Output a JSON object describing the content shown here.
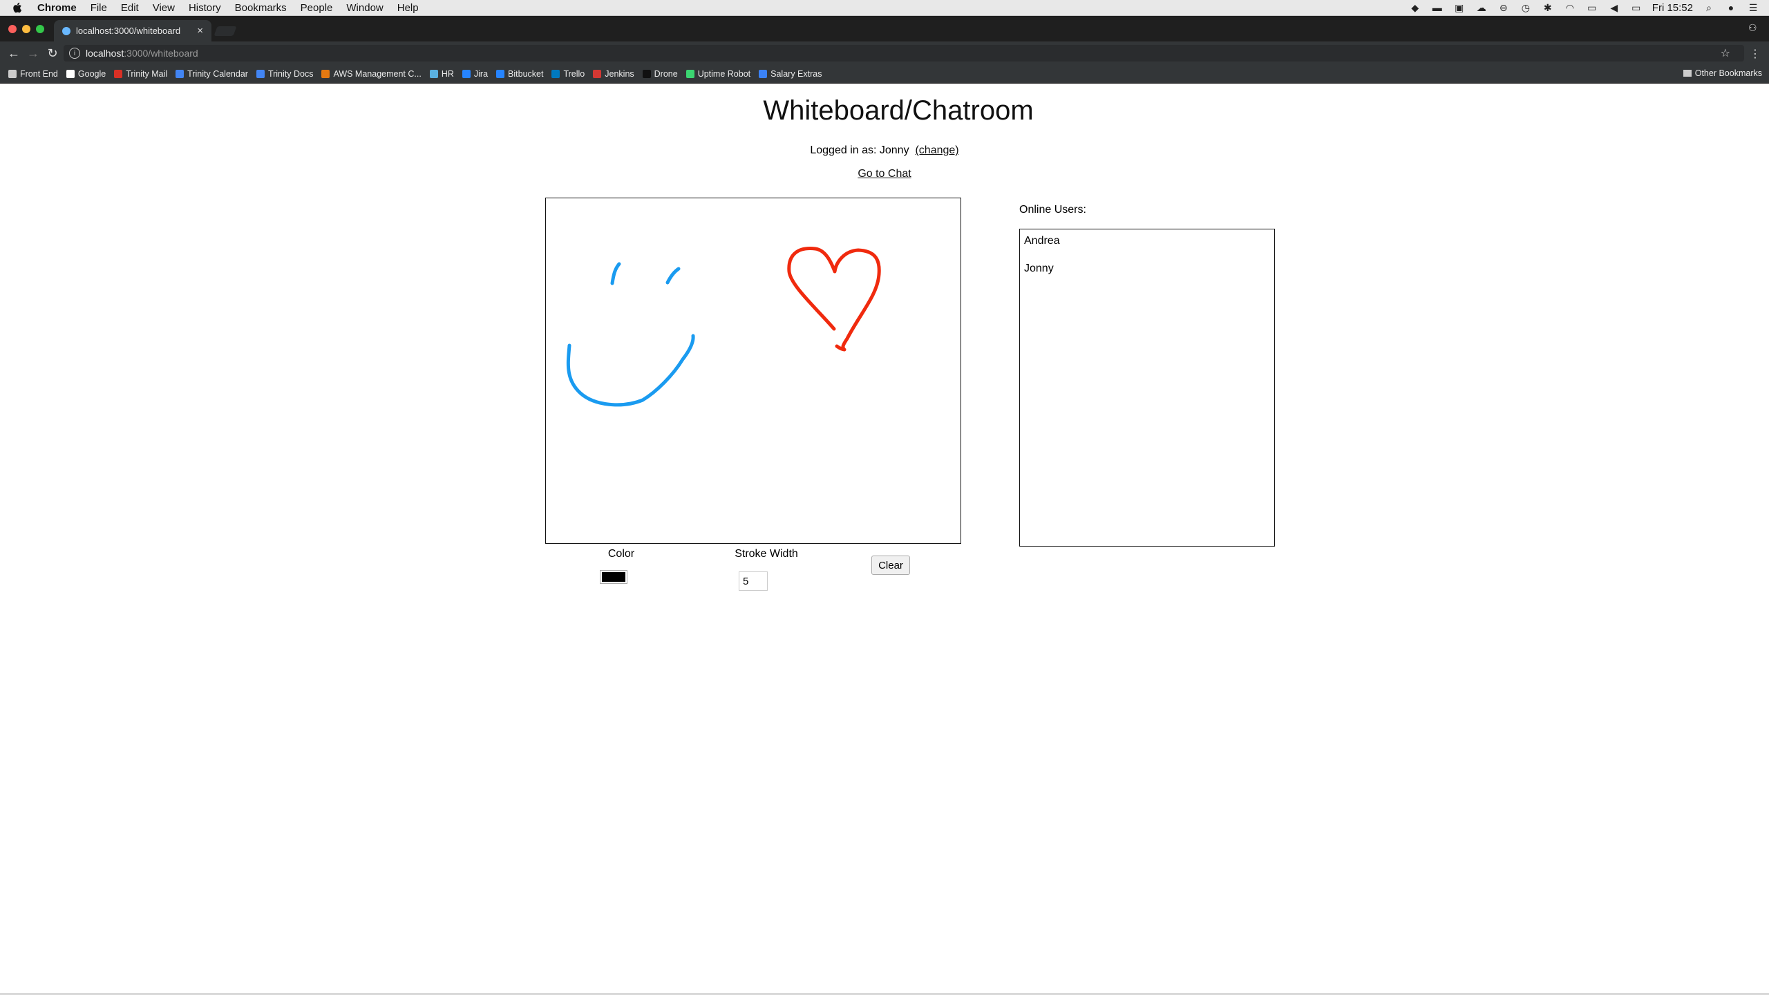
{
  "menubar": {
    "app": "Chrome",
    "items": [
      "File",
      "Edit",
      "View",
      "History",
      "Bookmarks",
      "People",
      "Window",
      "Help"
    ],
    "clock": "Fri 15:52"
  },
  "browser": {
    "tab_title": "localhost:3000/whiteboard",
    "url_host": "localhost",
    "url_path": ":3000/whiteboard",
    "bookmarks": [
      {
        "label": "Front End",
        "icon": "folder-icon",
        "color": "#cccccc"
      },
      {
        "label": "Google",
        "icon": "google-icon",
        "color": "#ffffff"
      },
      {
        "label": "Trinity Mail",
        "icon": "mail-icon",
        "color": "#d93025"
      },
      {
        "label": "Trinity Calendar",
        "icon": "calendar-icon",
        "color": "#4285f4"
      },
      {
        "label": "Trinity Docs",
        "icon": "docs-icon",
        "color": "#4285f4"
      },
      {
        "label": "AWS Management C...",
        "icon": "aws-icon",
        "color": "#e47911"
      },
      {
        "label": "HR",
        "icon": "hr-icon",
        "color": "#5ab0e0"
      },
      {
        "label": "Jira",
        "icon": "jira-icon",
        "color": "#2684ff"
      },
      {
        "label": "Bitbucket",
        "icon": "bitbucket-icon",
        "color": "#2684ff"
      },
      {
        "label": "Trello",
        "icon": "trello-icon",
        "color": "#0079bf"
      },
      {
        "label": "Jenkins",
        "icon": "jenkins-icon",
        "color": "#d33833"
      },
      {
        "label": "Drone",
        "icon": "drone-icon",
        "color": "#111111"
      },
      {
        "label": "Uptime Robot",
        "icon": "uptime-icon",
        "color": "#3bd671"
      },
      {
        "label": "Salary Extras",
        "icon": "salary-icon",
        "color": "#3b82f6"
      }
    ],
    "other_bookmarks": "Other Bookmarks"
  },
  "page": {
    "title": "Whiteboard/Chatroom",
    "logged_in_prefix": "Logged in as: Jonny",
    "change_link": "(change)",
    "go_to_chat": "Go to Chat",
    "color_label": "Color",
    "color_value": "#000000",
    "stroke_label": "Stroke Width",
    "stroke_value": "5",
    "clear_label": "Clear",
    "online_label": "Online Users:",
    "users": [
      "Andrea",
      "Jonny"
    ]
  },
  "drawing": {
    "strokes": [
      {
        "color": "#1a9bf0",
        "shape": "smile"
      },
      {
        "color": "#1a9bf0",
        "shape": "left-eye"
      },
      {
        "color": "#1a9bf0",
        "shape": "right-eye"
      },
      {
        "color": "#f02a0e",
        "shape": "heart"
      }
    ]
  }
}
